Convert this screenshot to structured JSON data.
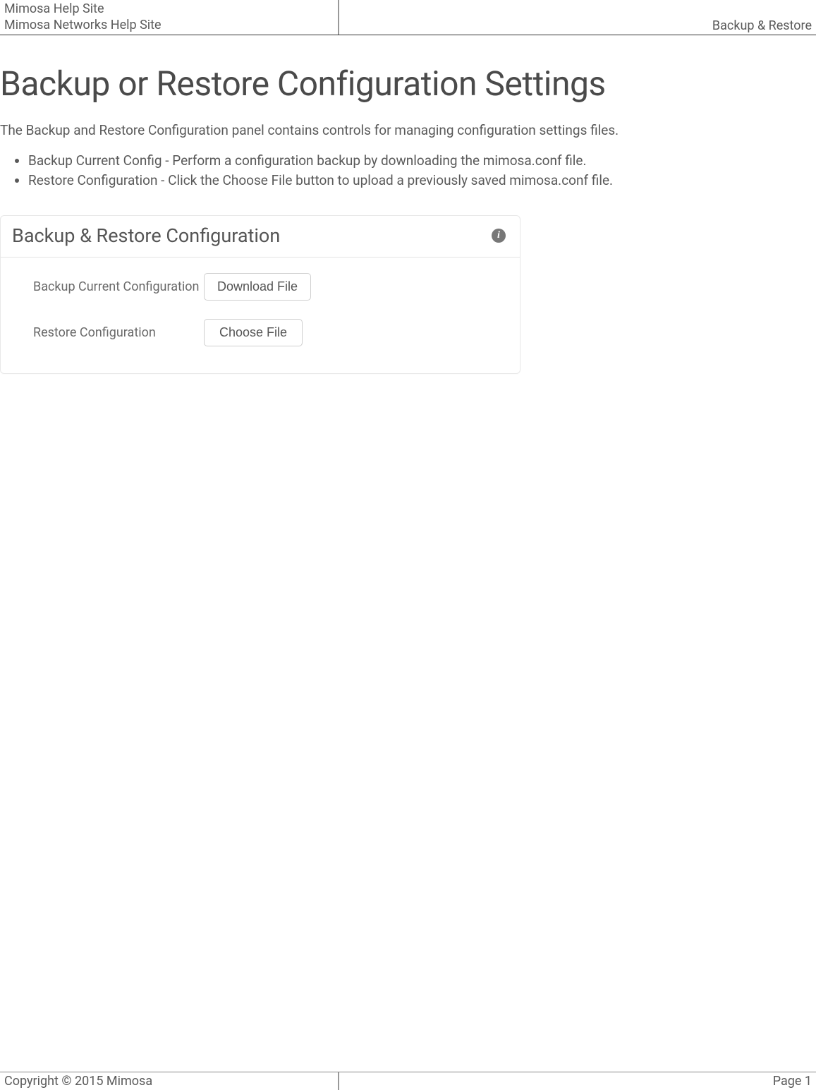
{
  "header": {
    "site_line1": "Mimosa Help Site",
    "site_line2": "Mimosa Networks Help Site",
    "section": "Backup & Restore"
  },
  "main": {
    "title": "Backup or Restore Configuration Settings",
    "intro": "The Backup and Restore Configuration panel contains controls for managing configuration settings files.",
    "bullets": [
      "Backup Current Config - Perform a configuration backup by downloading the mimosa.conf file.",
      "Restore Configuration - Click the Choose File button to upload a previously saved mimosa.conf file."
    ],
    "panel": {
      "title": "Backup & Restore Configuration",
      "info_glyph": "i",
      "rows": [
        {
          "label": "Backup Current Configuration",
          "button": "Download File"
        },
        {
          "label": "Restore Configuration",
          "button": "Choose File"
        }
      ]
    }
  },
  "footer": {
    "copyright": "Copyright © 2015 Mimosa",
    "page": "Page 1"
  }
}
